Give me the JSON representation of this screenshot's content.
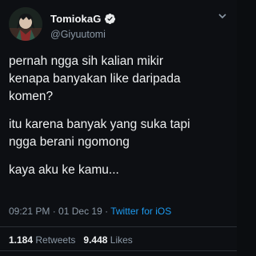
{
  "author": {
    "display_name": "TomiokaG",
    "handle": "@Giyuutomi",
    "avatar_icon": "profile-avatar",
    "verified_icon": "verified-badge-icon"
  },
  "tweet": {
    "paragraphs": [
      "pernah ngga sih kalian mikir\nkenapa banyakan like daripada\nkomen?",
      "itu karena banyak yang suka tapi\nngga berani ngomong",
      "kaya aku ke kamu..."
    ]
  },
  "meta": {
    "time": "09:21 PM",
    "separator": " · ",
    "date": "01 Dec 19",
    "source": "Twitter for iOS"
  },
  "stats": {
    "retweets_count": "1.184",
    "retweets_label": "Retweets",
    "likes_count": "9.448",
    "likes_label": "Likes"
  },
  "colors": {
    "background": "#0d0f13",
    "accent": "#1d9bf0",
    "muted_text": "#8b98a5"
  }
}
